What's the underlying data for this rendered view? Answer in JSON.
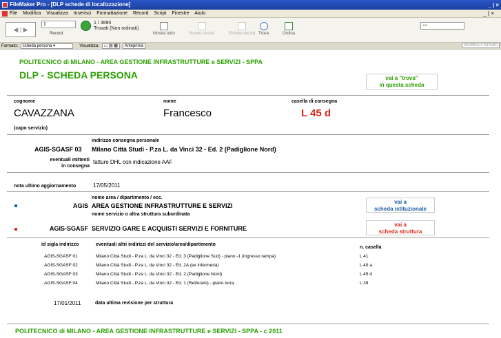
{
  "window": {
    "title": "FileMaker Pro - [DLP schede di localizzazione]",
    "controls": "_ | ×"
  },
  "menubar": {
    "items": [
      "File",
      "Modifica",
      "Visualizza",
      "Inserisci",
      "Formattazione",
      "Record",
      "Script",
      "Finestre",
      "Aiuto"
    ],
    "mdi_controls": "_ | ×"
  },
  "toolbar": {
    "record_value": "1",
    "record_label": "Record",
    "found_count": "1 / 3890",
    "found_status": "Trovati (Non ordinati)",
    "buttons": {
      "show_all": "Mostra tutto",
      "new_record": "Nuovo record",
      "delete_record": "Elimina record",
      "find": "Trova",
      "sort": "Ordina"
    }
  },
  "statusbar": {
    "format_label": "Formato:",
    "format_value": "scheda persona",
    "view_label": "Visualizza:",
    "preview_label": "Anteprima",
    "modify_label": "Modifica il formato"
  },
  "header": {
    "org": "POLITECNICO di MILANO - AREA GESTIONE INFRASTRUTTURE e SERVIZI - SPPA",
    "title": "DLP - SCHEDA PERSONA",
    "find_btn_line1": "vai a \"trova\"",
    "find_btn_line2": "in questa scheda"
  },
  "person": {
    "surname_label": "cognome",
    "surname": "CAVAZZANA",
    "name_label": "nome",
    "name": "Francesco",
    "box_label": "casella di consegna",
    "box": "L 45 d",
    "role": "(capo servizio)"
  },
  "delivery": {
    "address_label": "indirizzo consegna personale",
    "code": "AGIS-SGASF 03",
    "address": "Milano Città Studi - P.za L. da Vinci 32  - Ed. 2 (Padiglione Nord)",
    "senders_label_1": "eventuali mittenti",
    "senders_label_2": "in consegna",
    "senders": "fatture DHL con indicazione AAF",
    "update_label": "nota ultimo aggiornamento",
    "update_date": "17/05/2011"
  },
  "area": {
    "area_label": "nome area / dipartimento / ecc.",
    "area_code": "AGIS",
    "area_name": "AREA GESTIONE INFRASTRUTTURE E SERVIZI",
    "area_btn_1": "vai a",
    "area_btn_2": "scheda istituzionale",
    "service_label": "nome servizio o altra struttura subordinata",
    "service_code": "AGIS-SGASF",
    "service_name": "SERVIZIO GARE E ACQUISTI SERVIZI E FORNITURE",
    "service_btn_1": "vai a",
    "service_btn_2": "scheda struttura"
  },
  "other_addresses": {
    "id_header": "id sigla indirizzo",
    "addr_header": "eventuali altri indirizzi del servizio/area/dipartimento",
    "box_header": "n. casella",
    "rows": [
      {
        "id": "AGIS-SGASF 01",
        "addr": "Milano Città Studi - P.za L. da Vinci 32  - Ed. 3 (Padiglione Sud) - piano -1 (ingresso rampa)",
        "box": "L 41"
      },
      {
        "id": "AGIS-SGASF 02",
        "addr": "Milano Città Studi - P.za L. da Vinci 32  - Ed. 2A (ex infermeria)",
        "box": "L 40 a"
      },
      {
        "id": "AGIS-SGASF 03",
        "addr": "Milano Città Studi - P.za L. da Vinci 32  - Ed. 2 (Padiglione Nord)",
        "box": "L 45 d"
      },
      {
        "id": "AGIS-SGASF 04",
        "addr": "Milano Città Studi - P.za L. da Vinci 32  - Ed. 1 (Rettorato) - piano terra",
        "box": "L 39"
      }
    ],
    "revision_date": "17/01/2011",
    "revision_label": "data ultima revisione per struttura"
  },
  "footer": {
    "text": "POLITECNICO di MILANO - AREA GESTIONE INFRASTRUTTURE e SERVIZI - SPPA -  c 2011"
  },
  "colors": {
    "green": "#2aa000",
    "red": "#d8281d",
    "blue": "#1f5fa0",
    "titlebar": "#2a56c8"
  }
}
